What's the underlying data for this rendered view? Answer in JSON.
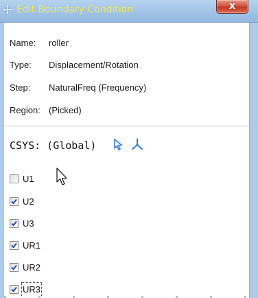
{
  "window": {
    "title": "Edit Boundary Condition",
    "close_glyph": "x"
  },
  "info": {
    "name_label": "Name:",
    "name_value": "roller",
    "type_label": "Type:",
    "type_value": "Displacement/Rotation",
    "step_label": "Step:",
    "step_value": "NaturalFreq (Frequency)",
    "region_label": "Region:",
    "region_value": "(Picked)"
  },
  "csys": {
    "label": "CSYS: (Global)",
    "icons": [
      "select-arrow-icon",
      "create-csys-axes-icon"
    ]
  },
  "dofs": [
    {
      "label": "U1",
      "checked": false
    },
    {
      "label": "U2",
      "checked": true
    },
    {
      "label": "U3",
      "checked": true
    },
    {
      "label": "UR1",
      "checked": true
    },
    {
      "label": "UR2",
      "checked": true
    },
    {
      "label": "UR3",
      "checked": true
    }
  ],
  "colors": {
    "title_text": "#f3e84a",
    "titlebar": "#a4c6e8",
    "close_button": "#c13a22",
    "icon_blue": "#2f7fd6",
    "check_blue": "#1f4fa8"
  }
}
